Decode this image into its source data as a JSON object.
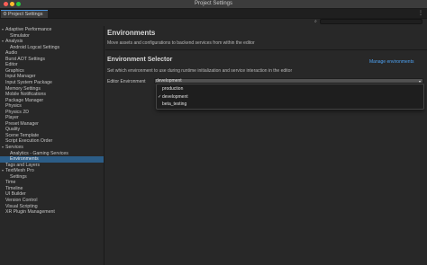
{
  "window": {
    "title": "Project Settings"
  },
  "tab": {
    "label": "Project Settings"
  },
  "sidebar": {
    "items": [
      {
        "label": "Adaptive Performance",
        "indent": 0,
        "expandable": true
      },
      {
        "label": "Simulator",
        "indent": 1
      },
      {
        "label": "Analysis",
        "indent": 0,
        "expandable": true
      },
      {
        "label": "Android Logcat Settings",
        "indent": 1
      },
      {
        "label": "Audio",
        "indent": 0
      },
      {
        "label": "Burst AOT Settings",
        "indent": 0
      },
      {
        "label": "Editor",
        "indent": 0
      },
      {
        "label": "Graphics",
        "indent": 0
      },
      {
        "label": "Input Manager",
        "indent": 0
      },
      {
        "label": "Input System Package",
        "indent": 0
      },
      {
        "label": "Memory Settings",
        "indent": 0
      },
      {
        "label": "Mobile Notifications",
        "indent": 0
      },
      {
        "label": "Package Manager",
        "indent": 0
      },
      {
        "label": "Physics",
        "indent": 0
      },
      {
        "label": "Physics 2D",
        "indent": 0
      },
      {
        "label": "Player",
        "indent": 0
      },
      {
        "label": "Preset Manager",
        "indent": 0
      },
      {
        "label": "Quality",
        "indent": 0
      },
      {
        "label": "Scene Template",
        "indent": 0
      },
      {
        "label": "Script Execution Order",
        "indent": 0
      },
      {
        "label": "Services",
        "indent": 0,
        "expandable": true
      },
      {
        "label": "Analytics - Gaming Services",
        "indent": 1
      },
      {
        "label": "Environments",
        "indent": 1,
        "selected": true
      },
      {
        "label": "Tags and Layers",
        "indent": 0
      },
      {
        "label": "TextMesh Pro",
        "indent": 0,
        "expandable": true
      },
      {
        "label": "Settings",
        "indent": 1
      },
      {
        "label": "Time",
        "indent": 0
      },
      {
        "label": "Timeline",
        "indent": 0
      },
      {
        "label": "UI Builder",
        "indent": 0
      },
      {
        "label": "Version Control",
        "indent": 0
      },
      {
        "label": "Visual Scripting",
        "indent": 0
      },
      {
        "label": "XR Plugin Management",
        "indent": 0
      }
    ]
  },
  "main": {
    "title": "Environments",
    "description": "Move assets and configurations to backend services from within the editor",
    "section_title": "Environment Selector",
    "manage_link": "Manage environments",
    "section_description": "Set which environment to use during runtime initialization and service interaction in the editor",
    "env_label": "Editor Environment",
    "env_value": "development",
    "options": [
      {
        "label": "production",
        "checked": false
      },
      {
        "label": "development",
        "checked": true
      },
      {
        "label": "beta_testing",
        "checked": false
      }
    ]
  },
  "colors": {
    "selection": "#2c5d87",
    "link": "#4ea3f4",
    "tab_accent": "#4a90d9"
  },
  "icons": {
    "tab": "gear-icon",
    "search": "search-icon",
    "dropdown": "chevron-down-icon",
    "check": "checkmark-icon"
  }
}
